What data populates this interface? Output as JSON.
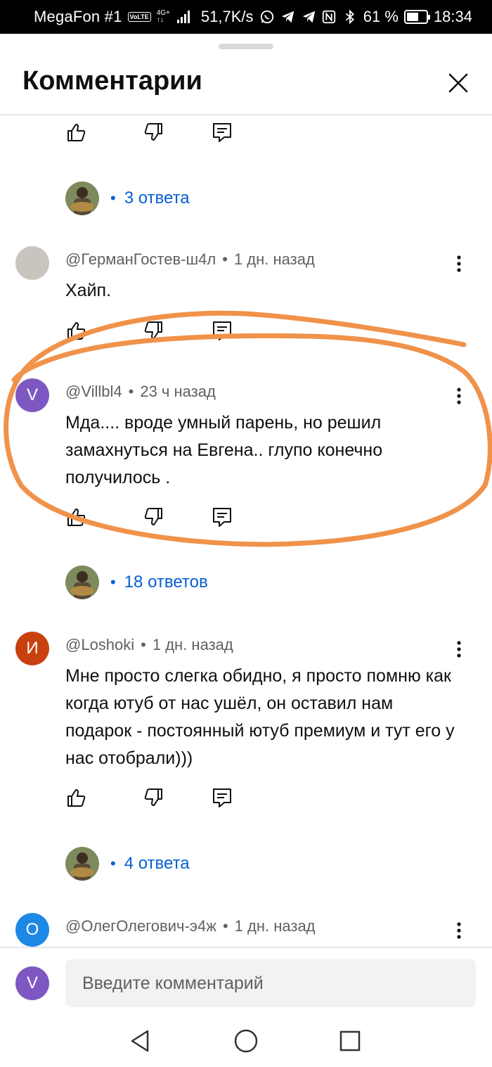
{
  "status_bar": {
    "carrier": "MegaFon #1",
    "volte": "VoLTE",
    "network_top": "4G+",
    "network_bottom": "↑↓",
    "speed": "51,7K/s",
    "battery": "61 %",
    "battery_level": 0.61,
    "time": "18:34"
  },
  "sheet": {
    "title": "Комментарии"
  },
  "thread_replies": [
    {
      "count_label": "3 ответа"
    },
    {
      "count_label": "18 ответов"
    },
    {
      "count_label": "4 ответа"
    }
  ],
  "comments": [
    {
      "author": "@ГерманГостев-ш4л",
      "time": "1 дн. назад",
      "text": "Хайп.",
      "avatar_letter": "",
      "avatar_color": "#c9c4bd"
    },
    {
      "author": "@Villbl4",
      "time": "23 ч назад",
      "text": "Мда.... вроде умный парень, но решил замахнуться на Евгена.. глупо конечно получилось .",
      "avatar_letter": "V",
      "avatar_color": "#7e57c2"
    },
    {
      "author": "@Loshoki",
      "time": "1 дн. назад",
      "text": "Мне просто слегка обидно, я просто помню как когда ютуб от нас ушёл, он оставил нам подарок - постоянный ютуб премиум и тут его у нас отобрали)))",
      "avatar_letter": "И",
      "avatar_color": "#c9400f"
    },
    {
      "author": "@ОлегОлегович-э4ж",
      "time": "1 дн. назад",
      "text": "",
      "avatar_letter": "О",
      "avatar_color": "#1e88e5"
    }
  ],
  "composer": {
    "avatar_letter": "V",
    "avatar_color": "#7e57c2",
    "placeholder": "Введите комментарий"
  },
  "colors": {
    "link_blue": "#065fd4",
    "annotation_orange": "#f0924a"
  }
}
